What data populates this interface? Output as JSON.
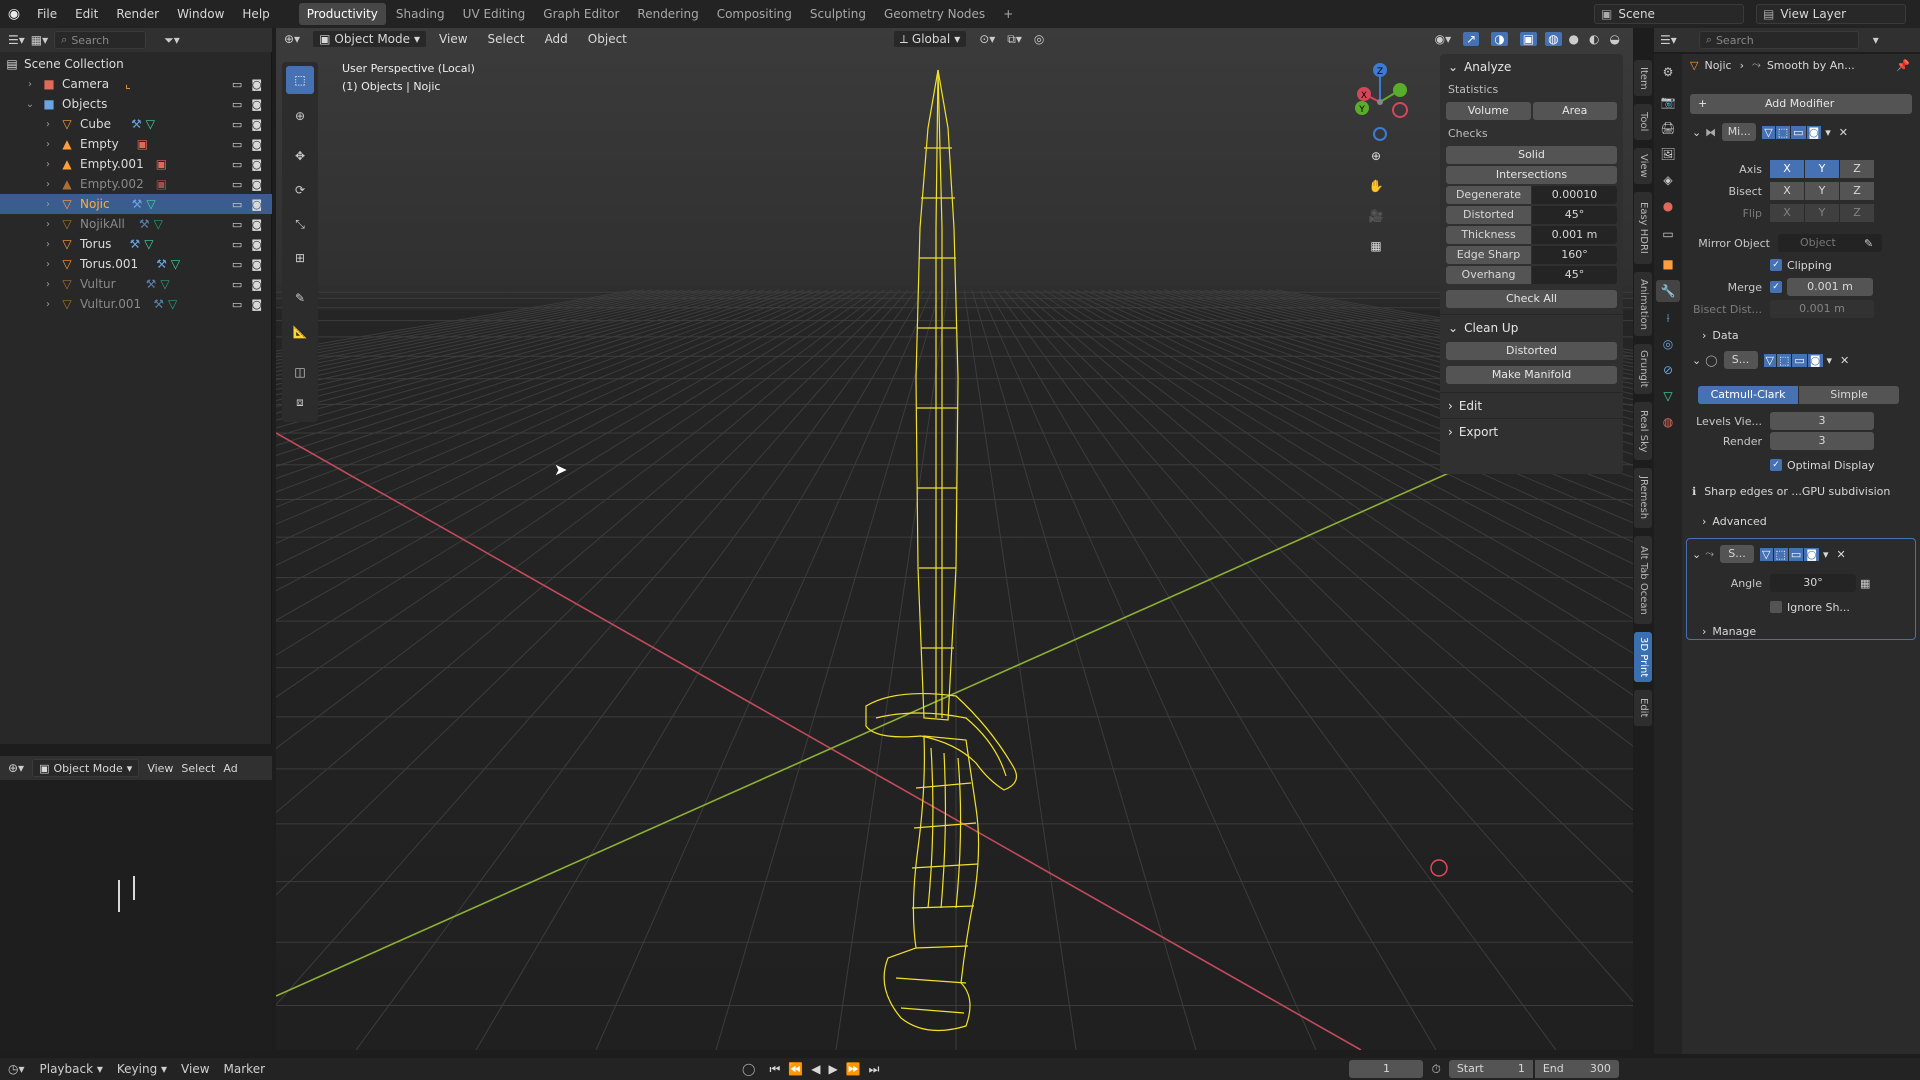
{
  "top_menu": [
    "File",
    "Edit",
    "Render",
    "Window",
    "Help"
  ],
  "workspaces": [
    "Productivity",
    "Shading",
    "UV Editing",
    "Graph Editor",
    "Rendering",
    "Compositing",
    "Sculpting",
    "Geometry Nodes"
  ],
  "active_workspace": "Productivity",
  "scene_name": "Scene",
  "view_layer": "View Layer",
  "outliner": {
    "search_placeholder": "Search",
    "scene_collection": "Scene Collection",
    "items": [
      {
        "name": "Camera",
        "dim": false
      },
      {
        "name": "Objects",
        "dim": false
      },
      {
        "name": "Cube",
        "dim": false
      },
      {
        "name": "Empty",
        "dim": false
      },
      {
        "name": "Empty.001",
        "dim": false
      },
      {
        "name": "Empty.002",
        "dim": true
      },
      {
        "name": "Nojic",
        "dim": false,
        "selected": true
      },
      {
        "name": "NojikAll",
        "dim": true
      },
      {
        "name": "Torus",
        "dim": false
      },
      {
        "name": "Torus.001",
        "dim": false
      },
      {
        "name": "Vultur",
        "dim": true
      },
      {
        "name": "Vultur.001",
        "dim": true
      }
    ]
  },
  "bottom_left": {
    "mode": "Object Mode",
    "menus": [
      "View",
      "Select",
      "Ad"
    ]
  },
  "viewport": {
    "mode": "Object Mode",
    "menus": [
      "View",
      "Select",
      "Add",
      "Object"
    ],
    "orientation": "Global",
    "overlay_title": "User Perspective (Local)",
    "overlay_sub": "(1) Objects | Nojic"
  },
  "npanel": {
    "analyze": "Analyze",
    "statistics": "Statistics",
    "volume": "Volume",
    "area": "Area",
    "checks": "Checks",
    "solid": "Solid",
    "intersections": "Intersections",
    "rows": [
      {
        "k": "Degenerate",
        "v": "0.00010"
      },
      {
        "k": "Distorted",
        "v": "45°"
      },
      {
        "k": "Thickness",
        "v": "0.001 m"
      },
      {
        "k": "Edge Sharp",
        "v": "160°"
      },
      {
        "k": "Overhang",
        "v": "45°"
      }
    ],
    "check_all": "Check All",
    "clean_up": "Clean Up",
    "distorted": "Distorted",
    "make_manifold": "Make Manifold",
    "edit": "Edit",
    "export": "Export"
  },
  "vtabs": [
    "Item",
    "Tool",
    "View",
    "Easy HDRI",
    "Animation",
    "Grungit",
    "Real Sky",
    "JRemesh",
    "Alt Tab Ocean",
    "3D Print",
    "Edit"
  ],
  "props": {
    "search_placeholder": "Search",
    "breadcrumb_obj": "Nojic",
    "breadcrumb_mod": "Smooth by An...",
    "add_modifier": "Add Modifier",
    "mirror": {
      "name": "Mi...",
      "axis": "Axis",
      "bisect": "Bisect",
      "flip": "Flip",
      "mirror_object": "Mirror Object",
      "object_placeholder": "Object",
      "clipping": "Clipping",
      "merge": "Merge",
      "merge_val": "0.001 m",
      "bisect_dist": "Bisect Dist...",
      "bisect_val": "0.001 m",
      "data": "Data"
    },
    "subsurf": {
      "name": "S...",
      "catmull": "Catmull-Clark",
      "simple": "Simple",
      "levels": "Levels Vie...",
      "levels_val": "3",
      "render": "Render",
      "render_val": "3",
      "optimal": "Optimal Display",
      "info": "Sharp edges or ...GPU subdivision",
      "advanced": "Advanced"
    },
    "smooth": {
      "name": "S...",
      "angle": "Angle",
      "angle_val": "30°",
      "ignore": "Ignore Sh...",
      "manage": "Manage"
    }
  },
  "timeline": {
    "menus": [
      "Playback",
      "Keying",
      "View",
      "Marker"
    ],
    "frame": "1",
    "start_label": "Start",
    "start": "1",
    "end_label": "End",
    "end": "300"
  },
  "colors": {
    "accent": "#4672b4",
    "selection": "#ffae3d",
    "wire": "#f2e12a"
  }
}
